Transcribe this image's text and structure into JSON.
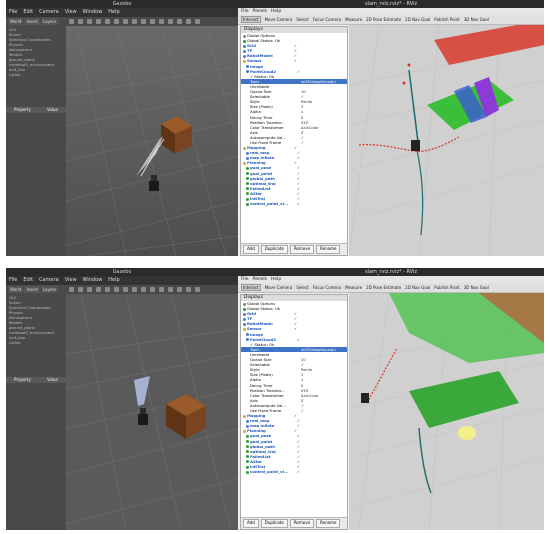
{
  "gazebo": {
    "title": "Gazebo",
    "menu": [
      "File",
      "Edit",
      "Camera",
      "View",
      "Window",
      "Help"
    ],
    "tabs": [
      "World",
      "Insert",
      "Layers"
    ],
    "tree_top": [
      "GUI",
      "Scene",
      "Spherical Coordinates",
      "Physics",
      "Atmosphere",
      "Models",
      "ground_plane",
      "turtlebot3_environment",
      "unit_box",
      "Lights"
    ],
    "tree_bottom": [
      "GUI",
      "Scene",
      "Spherical Coordinates",
      "Physics",
      "Atmosphere",
      "Models",
      "ground_plane",
      "turtlebot3_environment",
      "unit_box",
      "Lights"
    ],
    "property_label": "Property",
    "value_label": "Value"
  },
  "rviz": {
    "title": "slam_rviz.rviz* - RViz",
    "menu": [
      "File",
      "Panels",
      "Help"
    ],
    "tools": [
      "Interact",
      "Move Camera",
      "Select",
      "Focus Camera",
      "Measure",
      "2D Pose Estimate",
      "2D Nav Goal",
      "Publish Point",
      "3D Nav Goal"
    ],
    "displays_header": "Displays",
    "rows": [
      {
        "k": "Global Options",
        "v": "",
        "style": "plain",
        "icon": "gear"
      },
      {
        "k": "Global Status: Ok",
        "v": "",
        "style": "plain",
        "icon": "check"
      },
      {
        "k": "Grid",
        "v": "✓",
        "style": "blue",
        "icon": "grid"
      },
      {
        "k": "TF",
        "v": "✓",
        "style": "blue",
        "icon": "tf"
      },
      {
        "k": "RobotModel",
        "v": "✓",
        "style": "blue",
        "icon": "robot"
      },
      {
        "k": "Sensor",
        "v": "✓",
        "style": "blue",
        "icon": "folder"
      },
      {
        "k": "Image",
        "v": "",
        "style": "blue",
        "icon": "image"
      },
      {
        "k": "PointCloud2",
        "v": "✓",
        "style": "blue",
        "icon": "cloud"
      },
      {
        "k": "✓ Status: Ok",
        "v": "",
        "style": "plain",
        "icon": "none"
      },
      {
        "k": "Topic",
        "v": "/d435/depth/color/",
        "style": "sel",
        "icon": "none"
      },
      {
        "k": "Unreliable",
        "v": "",
        "style": "plain",
        "icon": "none"
      },
      {
        "k": "Queue Size",
        "v": "10",
        "style": "plain",
        "icon": "none"
      },
      {
        "k": "Selectable",
        "v": "✓",
        "style": "plain",
        "icon": "none"
      },
      {
        "k": "Style",
        "v": "Points",
        "style": "plain",
        "icon": "none"
      },
      {
        "k": "Size (Pixels)",
        "v": "3",
        "style": "plain",
        "icon": "none"
      },
      {
        "k": "Alpha",
        "v": "1",
        "style": "plain",
        "icon": "none"
      },
      {
        "k": "Decay Time",
        "v": "0",
        "style": "plain",
        "icon": "none"
      },
      {
        "k": "Position Transfor...",
        "v": "XYZ",
        "style": "plain",
        "icon": "none"
      },
      {
        "k": "Color Transformer",
        "v": "AxisColor",
        "style": "plain",
        "icon": "none"
      },
      {
        "k": "Axis",
        "v": "Z",
        "style": "plain",
        "icon": "none"
      },
      {
        "k": "Autocompute Val...",
        "v": "✓",
        "style": "plain",
        "icon": "none"
      },
      {
        "k": "Use Fixed Frame",
        "v": "✓",
        "style": "plain",
        "icon": "none"
      },
      {
        "k": "Mapping",
        "v": "✓",
        "style": "blue",
        "icon": "folder"
      },
      {
        "k": "real_map",
        "v": "✓",
        "style": "blue",
        "icon": "map"
      },
      {
        "k": "map inflate",
        "v": "✓",
        "style": "blue",
        "icon": "map"
      },
      {
        "k": "Planning",
        "v": "✓",
        "style": "blue",
        "icon": "folder"
      },
      {
        "k": "goal_pose",
        "v": "✓",
        "style": "blue",
        "icon": "green"
      },
      {
        "k": "goal_point",
        "v": "✓",
        "style": "blue",
        "icon": "green"
      },
      {
        "k": "global_path",
        "v": "✓",
        "style": "blue",
        "icon": "green"
      },
      {
        "k": "optimal_traj",
        "v": "✓",
        "style": "blue",
        "icon": "green"
      },
      {
        "k": "FailedList",
        "v": "✓",
        "style": "blue",
        "icon": "green"
      },
      {
        "k": "AStar",
        "v": "✓",
        "style": "blue",
        "icon": "green"
      },
      {
        "k": "initTraj",
        "v": "✓",
        "style": "blue",
        "icon": "green"
      },
      {
        "k": "control_point_vi...",
        "v": "✓",
        "style": "blue",
        "icon": "green"
      }
    ],
    "buttons": [
      "Add",
      "Duplicate",
      "Remove",
      "Rename"
    ]
  }
}
